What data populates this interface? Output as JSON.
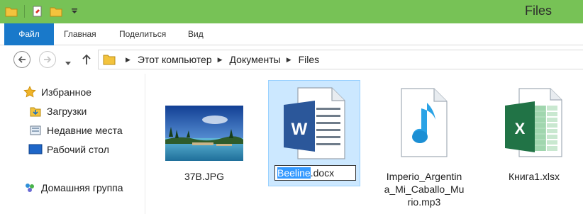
{
  "window": {
    "title": "Files",
    "accent": "#77c256"
  },
  "quick_access": [
    {
      "icon": "folder-icon"
    },
    {
      "icon": "properties-icon"
    },
    {
      "icon": "new-folder-icon"
    },
    {
      "icon": "customize-dropdown-icon"
    }
  ],
  "ribbon": {
    "tabs": [
      {
        "label": "Файл"
      },
      {
        "label": "Главная"
      },
      {
        "label": "Поделиться"
      },
      {
        "label": "Вид"
      }
    ],
    "file_tab_color": "#1979ca"
  },
  "address": {
    "crumbs": [
      {
        "label": "Этот компьютер"
      },
      {
        "label": "Документы"
      },
      {
        "label": "Files"
      }
    ]
  },
  "nav": {
    "items": [
      {
        "label": "Избранное",
        "icon": "star-icon"
      },
      {
        "label": "Загрузки",
        "icon": "downloads-folder-icon"
      },
      {
        "label": "Недавние места",
        "icon": "recent-places-icon"
      },
      {
        "label": "Рабочий стол",
        "icon": "desktop-icon"
      },
      {
        "label": "Домашняя группа",
        "icon": "homegroup-icon"
      }
    ]
  },
  "files": [
    {
      "name": "37B.JPG",
      "icon": "image-thumbnail"
    },
    {
      "name_selected": "Beeline",
      "name_rest": ".docx",
      "icon": "word-document-icon",
      "state": "renaming"
    },
    {
      "name": "Imperio_Argentina_Mi_Caballo_Murio.mp3",
      "name_lines": [
        "Imperio_Argentin",
        "a_Mi_Caballo_Mu",
        "rio.mp3"
      ],
      "icon": "music-file-icon"
    },
    {
      "name": "Книга1.xlsx",
      "icon": "excel-workbook-icon"
    }
  ]
}
